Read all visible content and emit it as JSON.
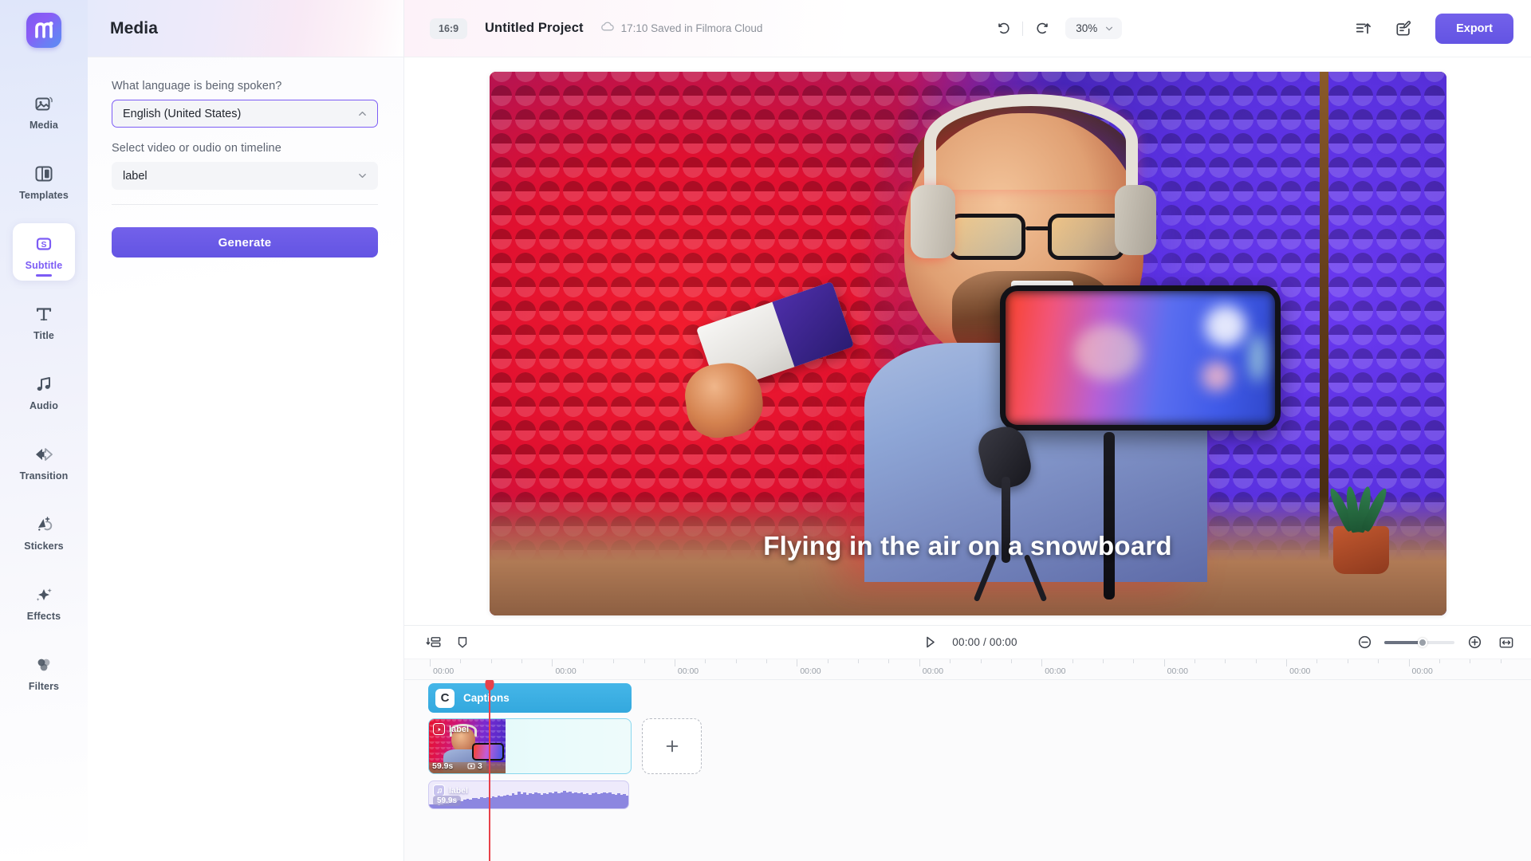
{
  "app": {
    "logo_name": "filmora-logo"
  },
  "sidebar": {
    "items": [
      {
        "label": "Media",
        "icon": "media-icon",
        "active": false
      },
      {
        "label": "Templates",
        "icon": "templates-icon",
        "active": false
      },
      {
        "label": "Subtitle",
        "icon": "subtitle-icon",
        "active": true
      },
      {
        "label": "Title",
        "icon": "title-icon",
        "active": false
      },
      {
        "label": "Audio",
        "icon": "audio-icon",
        "active": false
      },
      {
        "label": "Transition",
        "icon": "transition-icon",
        "active": false
      },
      {
        "label": "Stickers",
        "icon": "stickers-icon",
        "active": false
      },
      {
        "label": "Effects",
        "icon": "effects-icon",
        "active": false
      },
      {
        "label": "Filters",
        "icon": "filters-icon",
        "active": false
      }
    ]
  },
  "panel": {
    "title": "Media",
    "language_label": "What language is being spoken?",
    "language_value": "English (United States)",
    "source_label": "Select video or oudio on timeline",
    "source_value": "label",
    "generate_label": "Generate"
  },
  "topbar": {
    "aspect_ratio": "16:9",
    "project_name": "Untitled Project",
    "saved_status": "17:10 Saved in Filmora Cloud",
    "zoom_value": "30%",
    "export_label": "Export"
  },
  "preview": {
    "subtitle_text": "Flying in the air on a snowboard"
  },
  "timeline": {
    "current_time": "00:00",
    "total_time": "00:00",
    "time_display": "00:00 / 00:00",
    "ruler_labels": [
      "00:00",
      "00:00",
      "00:00",
      "00:00",
      "00:00",
      "00:00",
      "00:00",
      "00:00",
      "00:00"
    ],
    "tracks": {
      "captions": {
        "label": "Captions",
        "badge": "C"
      },
      "video": {
        "label": "label",
        "duration": "59.9s",
        "count": "3"
      },
      "audio": {
        "label": "label",
        "duration": "59.9s"
      }
    },
    "add_clip_label": "+"
  },
  "colors": {
    "accent_purple": "#6c5ce7",
    "captions_blue": "#33a8de",
    "playhead_red": "#e8414a",
    "audio_purple": "#8c86e0"
  }
}
